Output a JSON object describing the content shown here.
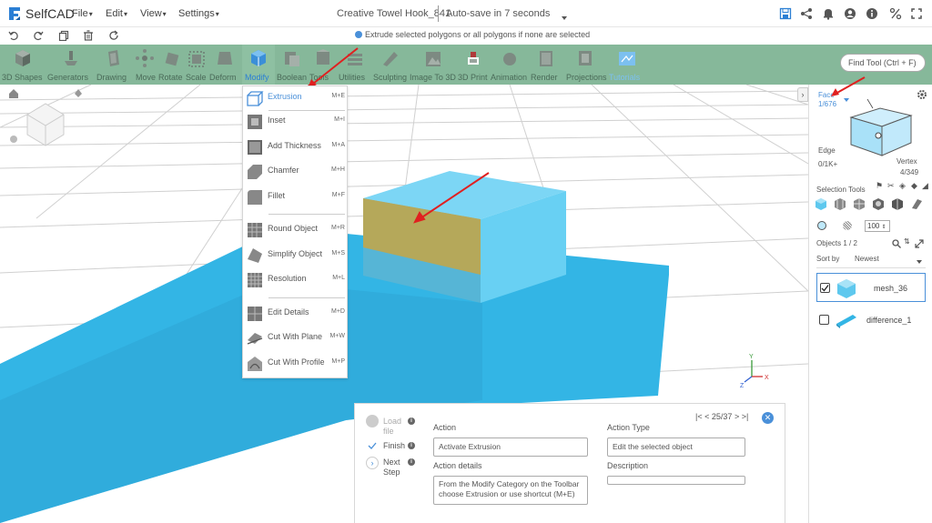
{
  "app": {
    "name": "SelfCAD"
  },
  "menubar": {
    "items": [
      {
        "label": "File"
      },
      {
        "label": "Edit"
      },
      {
        "label": "View"
      },
      {
        "label": "Settings"
      }
    ],
    "doc_title": "Creative Towel Hook_841",
    "autosave": "Auto-save in 7 seconds"
  },
  "hint": "Extrude selected polygons or all polygons if none are selected",
  "toolbar": {
    "tools": [
      {
        "label": "3D Shapes",
        "icon": "cube-icon"
      },
      {
        "label": "Generators",
        "icon": "generator-icon"
      },
      {
        "label": "Drawing",
        "icon": "drawing-icon"
      },
      {
        "label": "Move",
        "icon": "move-icon"
      },
      {
        "label": "Rotate",
        "icon": "rotate-icon"
      },
      {
        "label": "Scale",
        "icon": "scale-icon"
      },
      {
        "label": "Deform",
        "icon": "deform-icon"
      },
      {
        "label": "Modify",
        "icon": "modify-icon"
      },
      {
        "label": "Boolean",
        "icon": "boolean-icon"
      },
      {
        "label": "Tools",
        "icon": "tools-icon"
      },
      {
        "label": "Utilities",
        "icon": "utilities-icon"
      },
      {
        "label": "Sculpting",
        "icon": "sculpting-icon"
      },
      {
        "label": "Image To 3D",
        "icon": "image-to-3d-icon"
      },
      {
        "label": "3D Print",
        "icon": "3d-print-icon"
      },
      {
        "label": "Animation",
        "icon": "animation-icon"
      },
      {
        "label": "Render",
        "icon": "render-icon"
      },
      {
        "label": "Projections",
        "icon": "projections-icon"
      },
      {
        "label": "Tutorials",
        "icon": "tutorials-icon"
      }
    ],
    "find_tool_placeholder": "Find Tool (Ctrl + F)"
  },
  "modify_menu": {
    "items": [
      {
        "label": "Extrusion",
        "shortcut": "M+E"
      },
      {
        "label": "Inset",
        "shortcut": "M+I"
      },
      {
        "label": "Add Thickness",
        "shortcut": "M+A"
      },
      {
        "label": "Chamfer",
        "shortcut": "M+H"
      },
      {
        "label": "Fillet",
        "shortcut": "M+F"
      },
      {
        "label": "Round Object",
        "shortcut": "M+R"
      },
      {
        "label": "Simplify Object",
        "shortcut": "M+S"
      },
      {
        "label": "Resolution",
        "shortcut": "M+L"
      },
      {
        "label": "Edit Details",
        "shortcut": "M+D"
      },
      {
        "label": "Cut With Plane",
        "shortcut": "M+W"
      },
      {
        "label": "Cut With Profile",
        "shortcut": "M+P"
      }
    ]
  },
  "right_panel": {
    "face_label": "Face",
    "face_count": "1/676",
    "edge_label": "Edge",
    "edge_count": "0/1K+",
    "vertex_label": "Vertex",
    "vertex_count": "4/349",
    "selection_tools_label": "Selection Tools",
    "brush_size": "100",
    "objects_label": "Objects 1 / 2",
    "sort_label": "Sort by",
    "sort_value": "Newest",
    "objects": [
      {
        "name": "mesh_36",
        "checked": true
      },
      {
        "name": "difference_1",
        "checked": false
      }
    ]
  },
  "tutorial": {
    "steps": [
      {
        "label": "Load file"
      },
      {
        "label": "Finish"
      },
      {
        "label": "Next Step"
      }
    ],
    "action_label": "Action",
    "action_value": "Activate Extrusion",
    "action_details_label": "Action details",
    "action_details_value": "From the Modify Category on the Toolbar choose Extrusion or use shortcut (M+E)",
    "action_type_label": "Action Type",
    "action_type_value": "Edit the selected object",
    "description_label": "Description",
    "description_value": "",
    "pager": "25/37"
  },
  "colors": {
    "toolbar": "#86b89a",
    "accent": "#4a90d9",
    "mesh": "#5ec8ee",
    "selected_face": "#b5a85a",
    "arrow": "#e02020"
  }
}
